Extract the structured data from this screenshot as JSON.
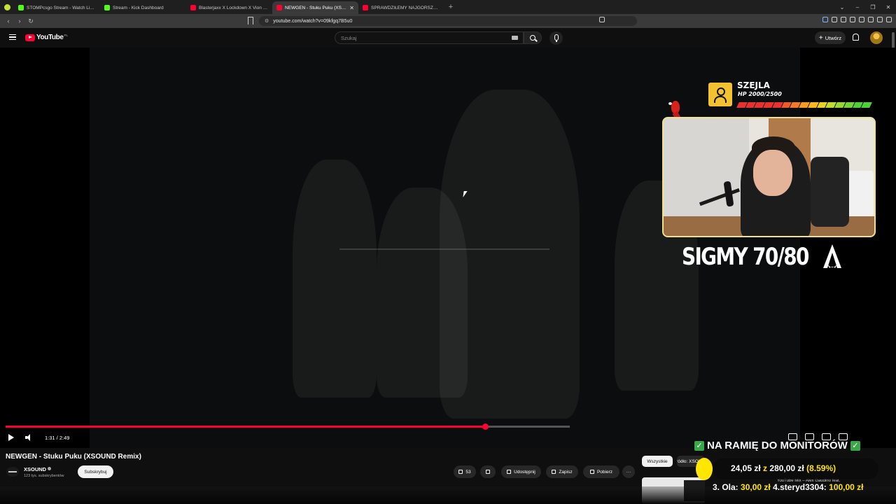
{
  "browser": {
    "tabs": [
      {
        "label": "STOMPcsgo Stream - Watch Live on Kick",
        "icon": "kick-icon",
        "active": false
      },
      {
        "label": "Stream - Kick Dashboard",
        "icon": "kick-icon",
        "active": false
      },
      {
        "label": "Blasterjaxx X Lockdown X Vion Konger",
        "icon": "youtube-icon",
        "active": false
      },
      {
        "label": "NEWGEN - Stuku Puku (XSOUND Remix)",
        "icon": "youtube-icon",
        "active": true
      },
      {
        "label": "SPRAWDZIŁEMY NAJGORSZE BÓLE",
        "icon": "youtube-icon",
        "active": false
      }
    ],
    "new_tab": "+",
    "url": "youtube.com/watch?v=09kfgq7B5u0",
    "window_controls": [
      "⌄",
      "–",
      "❐",
      "✕"
    ]
  },
  "youtube": {
    "logo_text": "YouTube",
    "country_code": "PL",
    "search_placeholder": "Szukaj",
    "create_label": "Utwórz",
    "create_plus": "+"
  },
  "overlay": {
    "streamer_name": "SZEJLA",
    "hp_text": "HP 2000/2500",
    "hp_fraction": 0.8,
    "hp_colors": [
      "#e8322d",
      "#e8322d",
      "#e8322d",
      "#e8322d",
      "#e8322d",
      "#f05a2a",
      "#f47a26",
      "#f79a22",
      "#f9b820",
      "#e8d223",
      "#c2dc2a",
      "#9bd82f",
      "#73d433",
      "#4fcf38",
      "#4fcf38"
    ],
    "sigmy_text": "SIGMY 70/80"
  },
  "player": {
    "time": "1:31 / 2:49",
    "played_fraction": 0.85,
    "buffer_fraction": 1.0
  },
  "video": {
    "title": "NEWGEN - Stuku Puku (XSOUND Remix)",
    "channel": "XSOUND",
    "subscribers": "123 tys. subskrybentów",
    "subscribe_label": "Subskrybuj",
    "likes": "53",
    "share_label": "Udostępnij",
    "save_label": "Zapisz",
    "download_label": "Pobierz",
    "more": "···"
  },
  "recommendations": {
    "chips": [
      "Wszystkie",
      "Źródło: XSOUND"
    ],
    "first_title": "YouTube Mix – Alex Gaudino feat."
  },
  "goal": {
    "title": "NA RAMIĘ DO MONITORÓW",
    "check": "✓",
    "current": "24,05 zł",
    "of": "z",
    "target": "280,00 zł",
    "percent": "(8.59%)",
    "ticker_a_name": "3. Ola:",
    "ticker_a_amount": "30,00 zł",
    "ticker_b_name": "4.steryd3304:",
    "ticker_b_amount": "100,00 zł"
  }
}
